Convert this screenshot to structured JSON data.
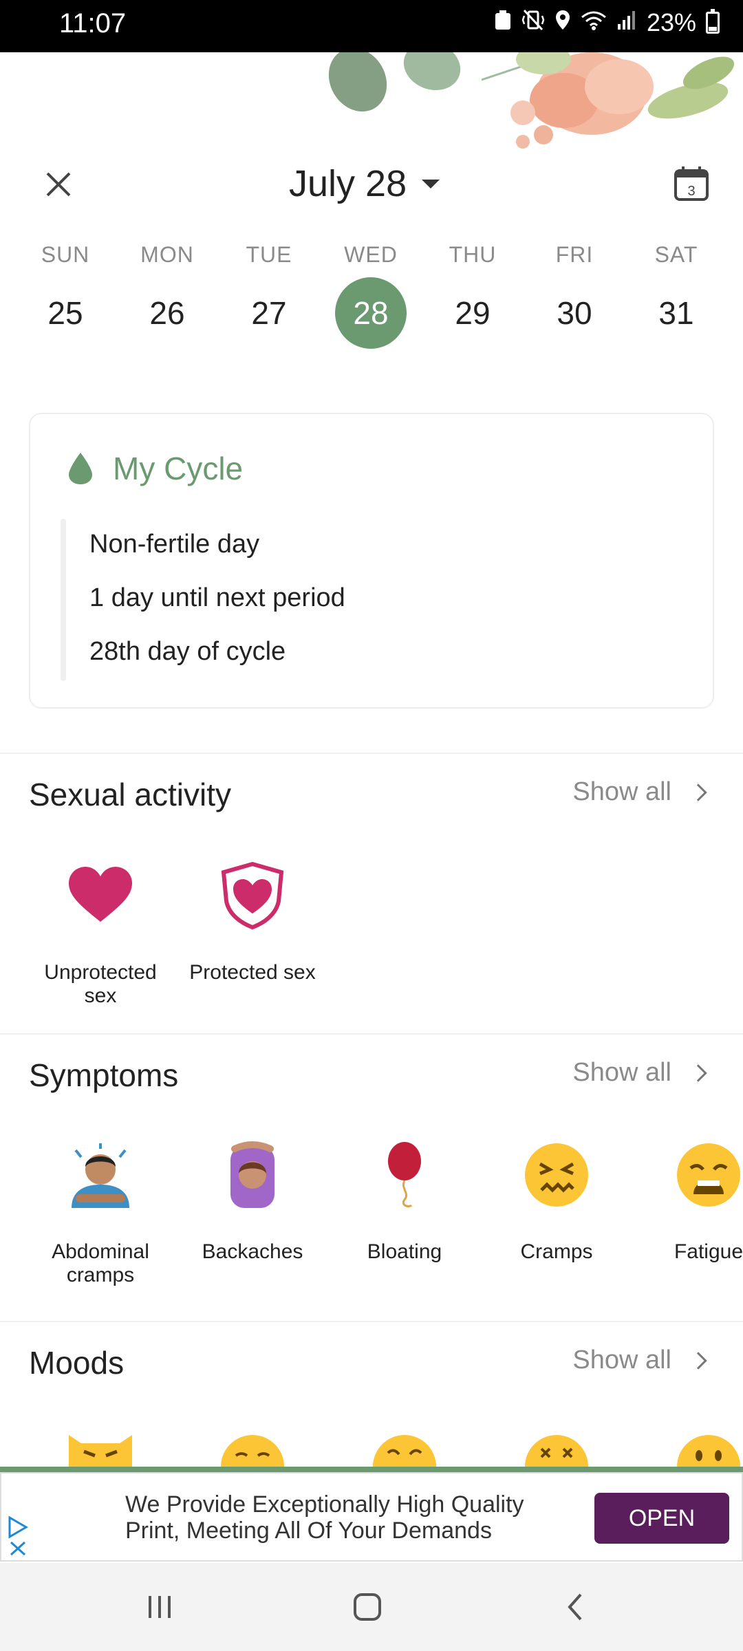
{
  "status_bar": {
    "time": "11:07",
    "battery": "23%"
  },
  "header": {
    "month_label": "July 28",
    "calendar_day": "3"
  },
  "week": {
    "days": [
      {
        "name": "SUN",
        "num": "25"
      },
      {
        "name": "MON",
        "num": "26"
      },
      {
        "name": "TUE",
        "num": "27"
      },
      {
        "name": "WED",
        "num": "28"
      },
      {
        "name": "THU",
        "num": "29"
      },
      {
        "name": "FRI",
        "num": "30"
      },
      {
        "name": "SAT",
        "num": "31"
      }
    ],
    "selected": "28"
  },
  "cycle": {
    "title": "My Cycle",
    "lines": [
      "Non-fertile day",
      "1 day until next period",
      "28th day of cycle"
    ]
  },
  "sexual_activity": {
    "title": "Sexual activity",
    "show_all": "Show all",
    "items": [
      {
        "label": "Unprotected sex",
        "icon": "heart-icon"
      },
      {
        "label": "Protected sex",
        "icon": "shield-heart-icon"
      }
    ]
  },
  "symptoms": {
    "title": "Symptoms",
    "show_all": "Show all",
    "items": [
      {
        "label": "Abdominal cramps",
        "icon": "abdominal-cramps-icon"
      },
      {
        "label": "Backaches",
        "icon": "backaches-icon"
      },
      {
        "label": "Bloating",
        "icon": "balloon-icon"
      },
      {
        "label": "Cramps",
        "icon": "confounded-face-icon"
      },
      {
        "label": "Fatigue",
        "icon": "weary-face-icon"
      }
    ]
  },
  "moods": {
    "title": "Moods",
    "show_all": "Show all"
  },
  "ad": {
    "text": "We Provide Exceptionally High Quality Print, Meeting All Of Your Demands",
    "cta": "OPEN"
  },
  "colors": {
    "accent": "#6b9a71",
    "heart": "#cc2d6a",
    "ad_button": "#5a1e5c"
  }
}
